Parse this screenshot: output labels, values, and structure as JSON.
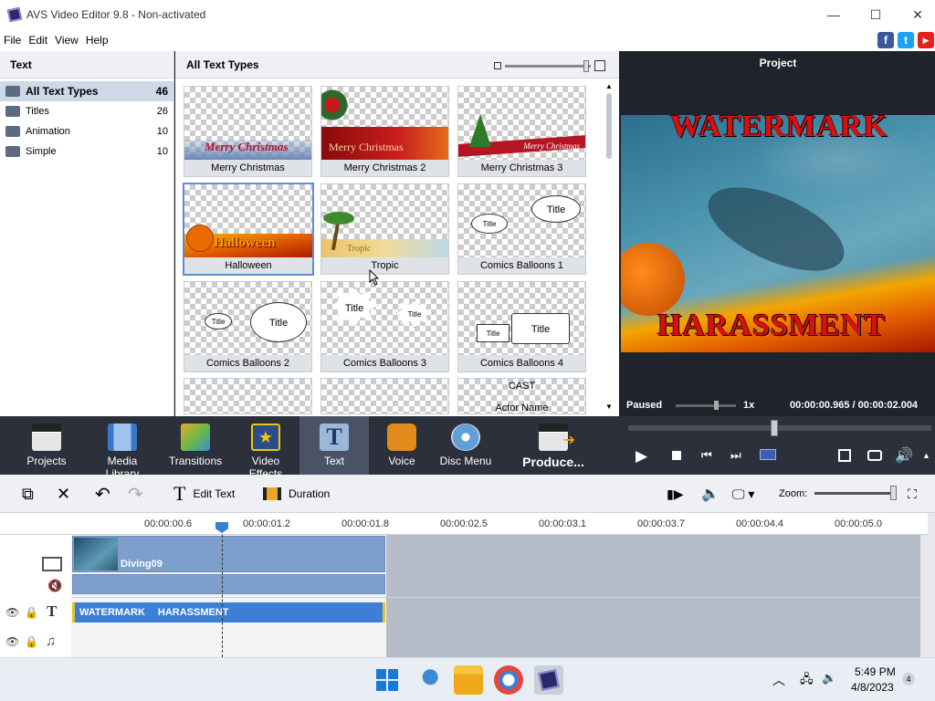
{
  "window": {
    "title": "AVS Video Editor 9.8 - Non-activated"
  },
  "menu": [
    "File",
    "Edit",
    "View",
    "Help"
  ],
  "social": [
    {
      "label": "f",
      "color": "#3b5998"
    },
    {
      "label": "t",
      "color": "#1da1f2"
    },
    {
      "label": "▶",
      "color": "#e62117"
    }
  ],
  "text_panel": {
    "header": "Text",
    "categories": [
      {
        "label": "All Text Types",
        "count": "46"
      },
      {
        "label": "Titles",
        "count": "26"
      },
      {
        "label": "Animation",
        "count": "10"
      },
      {
        "label": "Simple",
        "count": "10"
      }
    ]
  },
  "gallery": {
    "header": "All Text Types",
    "tiles": [
      "Merry Christmas",
      "Merry Christmas 2",
      "Merry Christmas 3",
      "Halloween",
      "Tropic",
      "Comics Balloons 1",
      "Comics Balloons 2",
      "Comics Balloons 3",
      "Comics Balloons 4",
      "",
      "",
      ""
    ],
    "thumb_text": {
      "mc1": "Merry Christmas",
      "mc2": "Merry Christmas",
      "mc3": "Merry Christmas",
      "halloween": "Halloween",
      "tropic": "Tropic",
      "title": "Title",
      "cast": "CAST",
      "actor": "Actor Name"
    }
  },
  "project": {
    "header": "Project",
    "overlay_top": "WATERMARK",
    "overlay_bottom": "HARASSMENT",
    "status": "Paused",
    "speed": "1x",
    "time": "00:00:00.965 / 00:00:02.004"
  },
  "toolbar": {
    "projects": "Projects",
    "media_library": "Media Library",
    "transitions": "Transitions",
    "video_effects": "Video Effects",
    "text": "Text",
    "voice": "Voice",
    "disc_menu": "Disc Menu",
    "produce": "Produce..."
  },
  "edit_toolbar": {
    "edit_text": "Edit Text",
    "duration": "Duration",
    "zoom": "Zoom:"
  },
  "ruler": [
    "00:00:00.6",
    "00:00:01.2",
    "00:00:01.8",
    "00:00:02.5",
    "00:00:03.1",
    "00:00:03.7",
    "00:00:04.4",
    "00:00:05.0"
  ],
  "timeline": {
    "video_clip": "Diving09",
    "text_clip_1": "WATERMARK",
    "text_clip_2": "HARASSMENT"
  },
  "taskbar": {
    "time": "5:49 PM",
    "date": "4/8/2023",
    "badge": "4"
  }
}
